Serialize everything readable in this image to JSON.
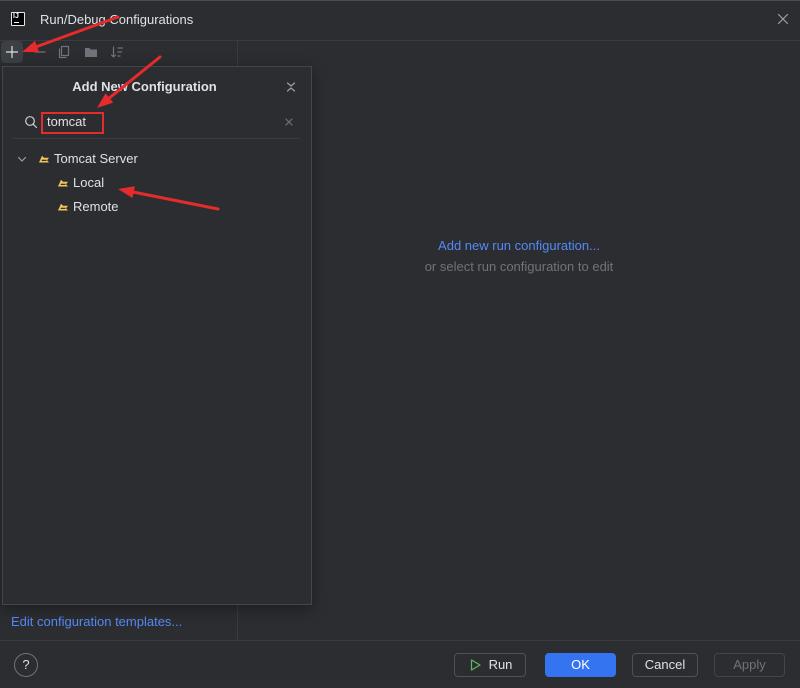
{
  "window": {
    "title": "Run/Debug Configurations",
    "app_icon": {
      "icon": "intellij-idea-icon",
      "text": "IJ"
    },
    "close_icon": "close-icon"
  },
  "sidebar": {
    "toolbar": [
      {
        "icon": "add-icon",
        "enabled": true
      },
      {
        "icon": "remove-icon",
        "enabled": false
      },
      {
        "icon": "copy-icon",
        "enabled": false
      },
      {
        "icon": "new-folder-icon",
        "enabled": false
      },
      {
        "icon": "sort-icon",
        "enabled": false
      }
    ],
    "templates_link": "Edit configuration templates..."
  },
  "popup": {
    "title": "Add New Configuration",
    "collapse_icon": "collapse-icon",
    "search": {
      "value": "tomcat",
      "icon": "search-icon",
      "clear_icon": "clear-icon"
    },
    "tree": [
      {
        "label": "Tomcat Server",
        "icon": "tomcat-icon",
        "expanded": true,
        "children": [
          {
            "label": "Local",
            "icon": "tomcat-icon"
          },
          {
            "label": "Remote",
            "icon": "tomcat-icon"
          }
        ]
      }
    ]
  },
  "main": {
    "add_link": "Add new run configuration...",
    "hint": "or select run configuration to edit"
  },
  "footer": {
    "help": {
      "label": "?",
      "icon": "help-icon"
    },
    "buttons": [
      {
        "label": "Run",
        "icon": "play-icon",
        "enabled": true
      },
      {
        "label": "OK",
        "enabled": true
      },
      {
        "label": "Cancel",
        "enabled": true
      },
      {
        "label": "Apply",
        "enabled": false
      }
    ]
  },
  "colors": {
    "background": "#2b2d30",
    "text": "#dfe1e5",
    "muted": "#6f737a",
    "link": "#548af7",
    "accent": "#3574f0",
    "border": "#4e5157",
    "separator": "#393b40",
    "run_green": "#5fb865",
    "tomcat_yellow": "#f2c55c",
    "annotation_red": "#e52b2b"
  }
}
